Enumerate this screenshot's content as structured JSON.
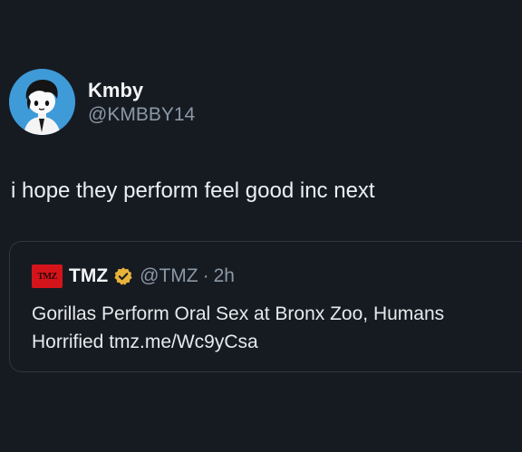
{
  "author": {
    "display_name": "Kmby",
    "handle": "@KMBBY14",
    "avatar_icon": "cartoon-avatar-icon"
  },
  "tweet": {
    "text": "i hope they perform feel good inc next"
  },
  "quoted_tweet": {
    "logo_text": "TMZ",
    "display_name": "TMZ",
    "verified_icon": "verified-badge-icon",
    "handle": "@TMZ",
    "separator": "·",
    "time": "2h",
    "text_line1": "Gorillas Perform Oral Sex at Bronx Zoo, Humans",
    "text_line2": "Horrified tmz.me/Wc9yCsa"
  },
  "colors": {
    "background": "#161b22",
    "text_primary": "#e7e9ea",
    "text_secondary": "#8b98a5",
    "avatar_background": "#3f9ad8",
    "tmz_red": "#d4141b",
    "verified_gold": "#e8b339",
    "card_border": "#2f3640"
  }
}
